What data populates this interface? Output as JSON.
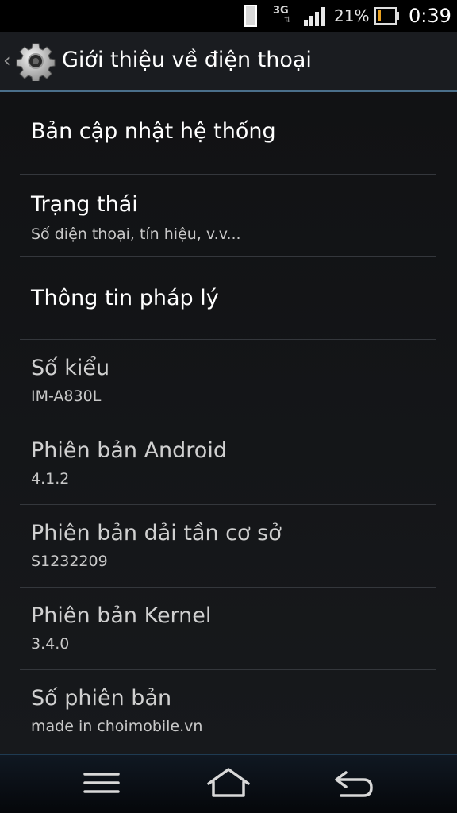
{
  "status_bar": {
    "network_type": "3G",
    "battery_percent": "21%",
    "battery_level": 0.21,
    "time": "0:39"
  },
  "action_bar": {
    "title": "Giới thiệu về điện thoại",
    "icon": "settings-gear-icon"
  },
  "list": {
    "items": [
      {
        "title": "Bản cập nhật hệ thống",
        "subtitle": ""
      },
      {
        "title": "Trạng thái",
        "subtitle": "Số điện thoại, tín hiệu, v.v..."
      },
      {
        "title": "Thông tin pháp lý",
        "subtitle": ""
      },
      {
        "title": "Số kiểu",
        "subtitle": "IM-A830L"
      },
      {
        "title": "Phiên bản Android",
        "subtitle": "4.1.2"
      },
      {
        "title": "Phiên bản dải tần cơ sở",
        "subtitle": "S1232209"
      },
      {
        "title": "Phiên bản Kernel",
        "subtitle": "3.4.0"
      },
      {
        "title": "Số phiên bản",
        "subtitle": "made in choimobile.vn"
      }
    ]
  },
  "nav_bar": {
    "buttons": [
      "menu-icon",
      "home-icon",
      "back-icon"
    ]
  }
}
